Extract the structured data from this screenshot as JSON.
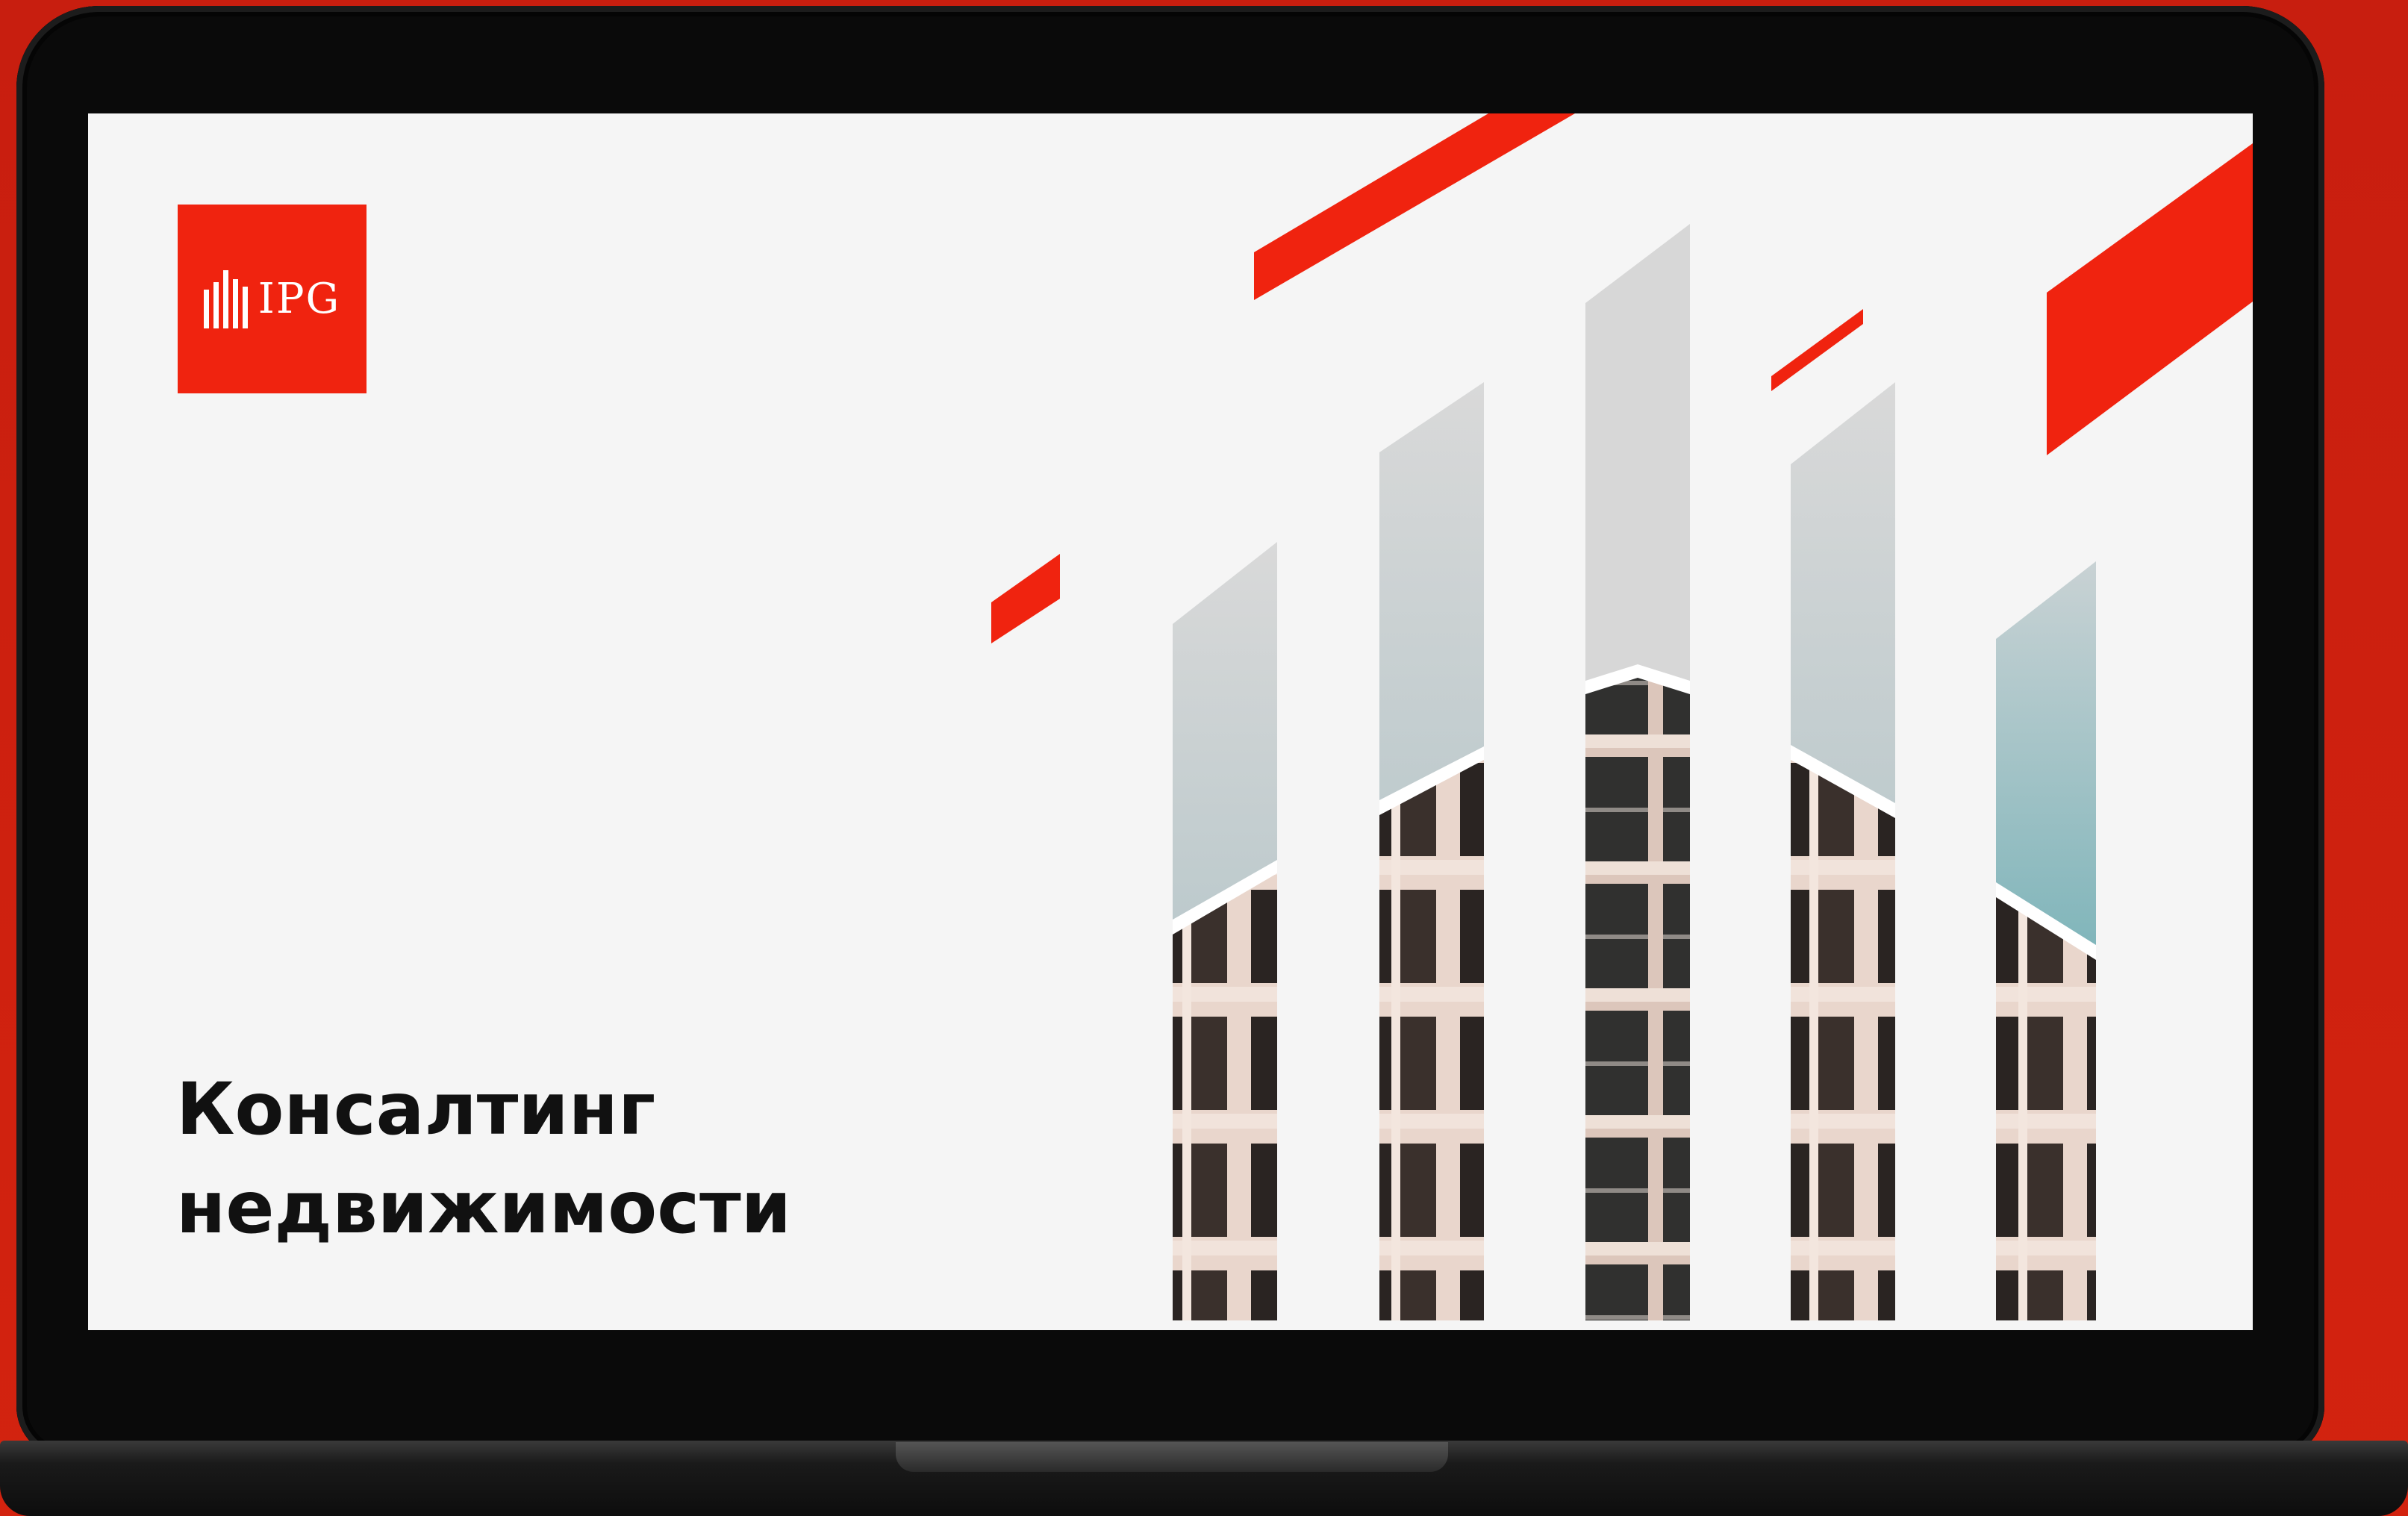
{
  "slide": {
    "logo_text": "IPG",
    "headline_line1": "Консалтинг",
    "headline_line2": "недвижимости"
  },
  "colors": {
    "accent": "#f0230f",
    "background": "#c81e0f",
    "screen": "#f5f5f5",
    "bezel": "#0a0a0a"
  },
  "icons": [
    "ipg-logo-icon",
    "building-strips-image"
  ]
}
